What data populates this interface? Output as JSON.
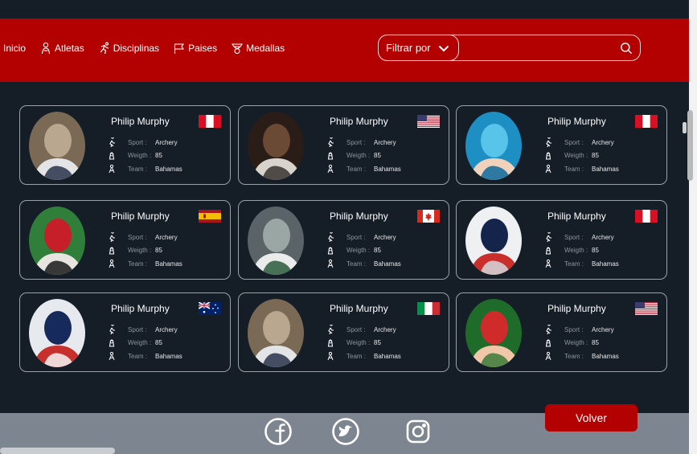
{
  "nav": {
    "items": [
      {
        "label": "Inicio",
        "icon": ""
      },
      {
        "label": "Atletas",
        "icon": "athlete-icon"
      },
      {
        "label": "Disciplinas",
        "icon": "runner-icon"
      },
      {
        "label": "Paises",
        "icon": "flag-icon"
      },
      {
        "label": "Medallas",
        "icon": "medal-icon"
      }
    ]
  },
  "filter": {
    "label": "Filtrar por",
    "query": ""
  },
  "athletes": [
    {
      "name": "Philip Murphy",
      "flag": "peru",
      "sport_label": "Sport :",
      "sport": "Archery",
      "weight_label": "Weigth :",
      "weight": "85",
      "team_label": "Team :",
      "team": "Bahamas"
    },
    {
      "name": "Philip Murphy",
      "flag": "usa",
      "sport_label": "Sport :",
      "sport": "Archery",
      "weight_label": "Weigth :",
      "weight": "85",
      "team_label": "Team :",
      "team": "Bahamas"
    },
    {
      "name": "Philip Murphy",
      "flag": "peru",
      "sport_label": "Sport :",
      "sport": "Archery",
      "weight_label": "Weigth :",
      "weight": "85",
      "team_label": "Team :",
      "team": "Bahamas"
    },
    {
      "name": "Philip Murphy",
      "flag": "spain",
      "sport_label": "Sport :",
      "sport": "Archery",
      "weight_label": "Weigth :",
      "weight": "85",
      "team_label": "Team :",
      "team": "Bahamas"
    },
    {
      "name": "Philip Murphy",
      "flag": "canada",
      "sport_label": "Sport :",
      "sport": "Archery",
      "weight_label": "Weigth :",
      "weight": "85",
      "team_label": "Team :",
      "team": "Bahamas"
    },
    {
      "name": "Philip Murphy",
      "flag": "peru",
      "sport_label": "Sport :",
      "sport": "Archery",
      "weight_label": "Weigth :",
      "weight": "85",
      "team_label": "Team :",
      "team": "Bahamas"
    },
    {
      "name": "Philip Murphy",
      "flag": "australia",
      "sport_label": "Sport :",
      "sport": "Archery",
      "weight_label": "Weigth :",
      "weight": "85",
      "team_label": "Team :",
      "team": "Bahamas"
    },
    {
      "name": "Philip Murphy",
      "flag": "italy",
      "sport_label": "Sport :",
      "sport": "Archery",
      "weight_label": "Weigth :",
      "weight": "85",
      "team_label": "Team :",
      "team": "Bahamas"
    },
    {
      "name": "Philip Murphy",
      "flag": "usa",
      "sport_label": "Sport :",
      "sport": "Archery",
      "weight_label": "Weigth :",
      "weight": "85",
      "team_label": "Team :",
      "team": "Bahamas"
    }
  ],
  "footer": {
    "volver_label": "Volver",
    "social": [
      "facebook-icon",
      "twitter-icon",
      "instagram-icon"
    ]
  },
  "colors": {
    "brand_red": "#b30000",
    "background": "#151d27",
    "footer_gray": "#7d8590"
  }
}
